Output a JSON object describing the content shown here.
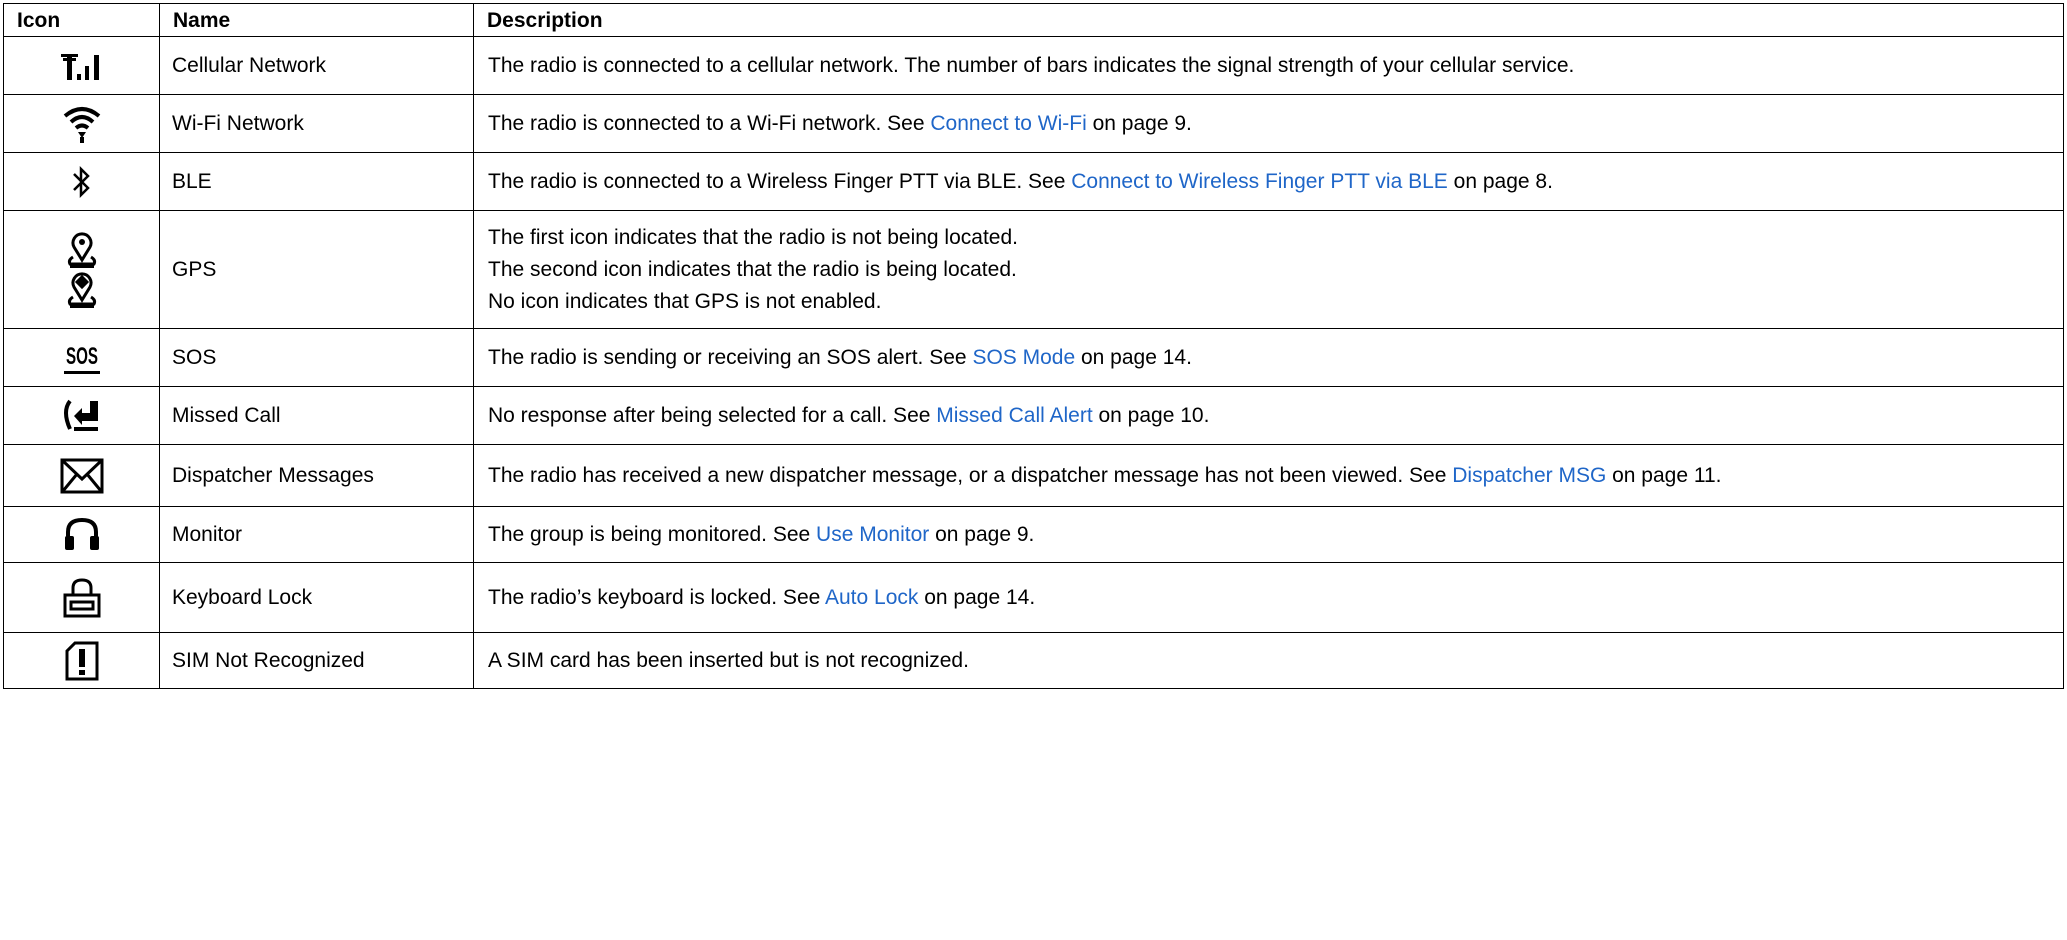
{
  "headers": {
    "icon": "Icon",
    "name": "Name",
    "description": "Description"
  },
  "rows": [
    {
      "icon": "cellular-signal-icon",
      "name": "Cellular Network",
      "text1": "The radio is connected to a cellular network. The number of bars indicates the signal strength of your cellular service."
    },
    {
      "icon": "wifi-icon",
      "name": "Wi-Fi Network",
      "text1": "The radio is connected to a Wi-Fi network. See ",
      "link": "Connect to Wi-Fi",
      "text2": " on page 9."
    },
    {
      "icon": "bluetooth-icon",
      "name": "BLE",
      "text1": "The radio is connected to a Wireless Finger PTT via BLE. See ",
      "link": "Connect to Wireless Finger PTT via BLE",
      "text2": " on page 8."
    },
    {
      "icon": "gps-location-icon",
      "name": "GPS",
      "lines": [
        "The first icon indicates that the radio is not being located.",
        "The second icon indicates that the radio is being located.",
        "No icon indicates that GPS is not enabled."
      ]
    },
    {
      "icon": "sos-icon",
      "icon_text": "SOS",
      "name": "SOS",
      "text1": "The radio is sending or receiving an SOS alert. See ",
      "link": "SOS Mode",
      "text2": " on page 14."
    },
    {
      "icon": "missed-call-icon",
      "name": "Missed Call",
      "text1": "No response after being selected for a call. See ",
      "link": "Missed Call Alert",
      "text2": " on page 10."
    },
    {
      "icon": "envelope-icon",
      "name": "Dispatcher Messages",
      "text1": "The radio has received a new dispatcher message, or a dispatcher message has not been viewed. See ",
      "link": "Dispatcher MSG",
      "text2": " on page 11."
    },
    {
      "icon": "headphones-icon",
      "name": "Monitor",
      "text1": "The group is being monitored. See ",
      "link": "Use Monitor",
      "text2": " on page 9."
    },
    {
      "icon": "keyboard-lock-icon",
      "name": "Keyboard Lock",
      "text1": "The radio’s keyboard is locked. See ",
      "link": "Auto Lock",
      "text2": " on page 14."
    },
    {
      "icon": "sim-alert-icon",
      "name": "SIM Not Recognized",
      "text1": "A SIM card has been inserted but is not recognized."
    }
  ],
  "colors": {
    "link": "#1f66c8",
    "border": "#000000",
    "text": "#000000"
  }
}
